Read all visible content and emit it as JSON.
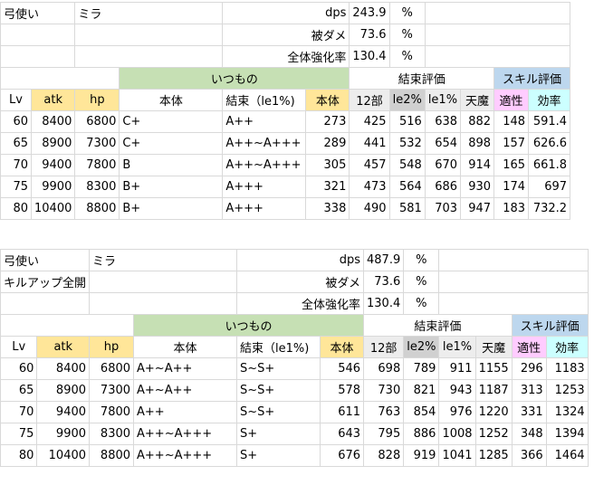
{
  "colors": {
    "green": "#c6e0b4",
    "orange": "#ffe699",
    "gray": "#d0d0d0",
    "blue": "#bdd7ee",
    "pink": "#ffccff",
    "cyan": "#ccffff"
  },
  "tables": [
    {
      "meta": [
        {
          "a": "弓使い",
          "b": "ミラ",
          "key": "dps",
          "val": "243.9",
          "unit": "%"
        },
        {
          "a": "",
          "b": "",
          "key": "被ダメ",
          "val": "73.6",
          "unit": "%"
        },
        {
          "a": "",
          "b": "",
          "key": "全体強化率",
          "val": "130.4",
          "unit": "%"
        }
      ],
      "groups": {
        "itsumono": "いつもの",
        "kessoku": "結束評価",
        "skill": "スキル評価"
      },
      "headers": [
        "Lv",
        "atk",
        "hp",
        "本体",
        "結束（le1%)",
        "本体",
        "12部",
        "le2%",
        "le1%",
        "天魔",
        "適性",
        "効率"
      ],
      "rows": [
        [
          "60",
          "8400",
          "6800",
          "C+",
          "A++",
          "273",
          "425",
          "516",
          "638",
          "882",
          "148",
          "591.4"
        ],
        [
          "65",
          "8900",
          "7300",
          "C+",
          "A++~A+++",
          "289",
          "441",
          "532",
          "654",
          "898",
          "157",
          "626.6"
        ],
        [
          "70",
          "9400",
          "7800",
          "B",
          "A++~A+++",
          "305",
          "457",
          "548",
          "670",
          "914",
          "165",
          "661.8"
        ],
        [
          "75",
          "9900",
          "8300",
          "B+",
          "A+++",
          "321",
          "473",
          "564",
          "686",
          "930",
          "174",
          "697"
        ],
        [
          "80",
          "10400",
          "8800",
          "B+",
          "A+++",
          "338",
          "490",
          "581",
          "703",
          "947",
          "183",
          "732.2"
        ]
      ]
    },
    {
      "meta": [
        {
          "a": "弓使い",
          "b": "ミラ",
          "key": "dps",
          "val": "487.9",
          "unit": "%"
        },
        {
          "a": "キルアップ全開",
          "b": "",
          "key": "被ダメ",
          "val": "73.6",
          "unit": "%"
        },
        {
          "a": "",
          "b": "",
          "key": "全体強化率",
          "val": "130.4",
          "unit": "%"
        }
      ],
      "groups": {
        "itsumono": "いつもの",
        "kessoku": "結束評価",
        "skill": "スキル評価"
      },
      "headers": [
        "Lv",
        "atk",
        "hp",
        "本体",
        "結束（le1%)",
        "本体",
        "12部",
        "le2%",
        "le1%",
        "天魔",
        "適性",
        "効率"
      ],
      "rows": [
        [
          "60",
          "8400",
          "6800",
          "A+~A++",
          "S~S+",
          "546",
          "698",
          "789",
          "911",
          "1155",
          "296",
          "1183"
        ],
        [
          "65",
          "8900",
          "7300",
          "A+~A++",
          "S~S+",
          "578",
          "730",
          "821",
          "943",
          "1187",
          "313",
          "1253"
        ],
        [
          "70",
          "9400",
          "7800",
          "A++",
          "S~S+",
          "611",
          "763",
          "854",
          "976",
          "1220",
          "331",
          "1324"
        ],
        [
          "75",
          "9900",
          "8300",
          "A++~A+++",
          "S+",
          "643",
          "795",
          "886",
          "1008",
          "1252",
          "348",
          "1394"
        ],
        [
          "80",
          "10400",
          "8800",
          "A++~A+++",
          "S+",
          "676",
          "828",
          "919",
          "1041",
          "1285",
          "366",
          "1464"
        ]
      ]
    }
  ]
}
